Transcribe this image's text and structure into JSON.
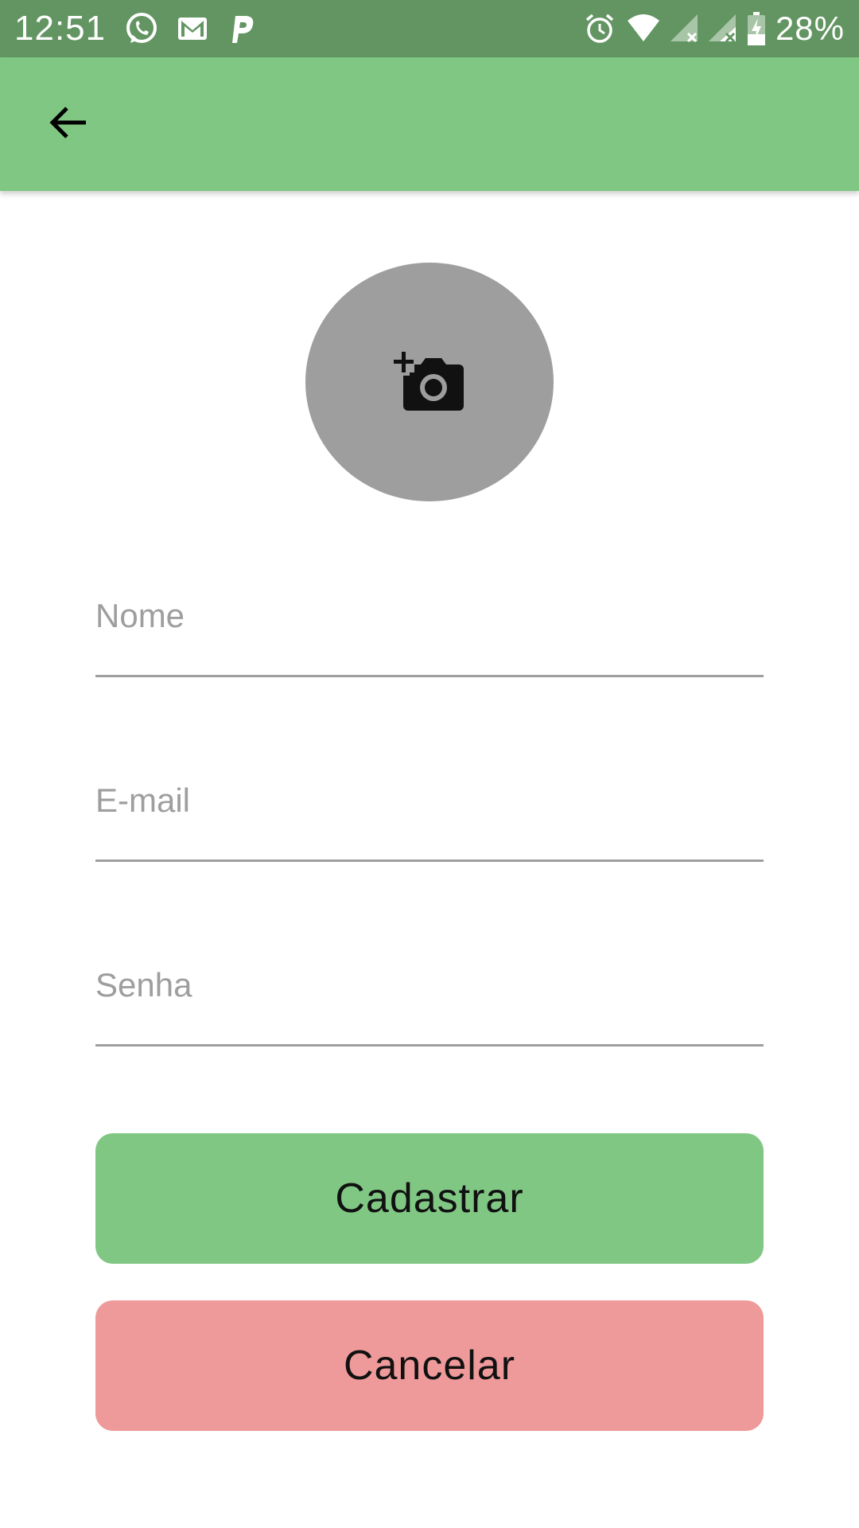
{
  "status_bar": {
    "time": "12:51",
    "battery": "28%",
    "background": "#629562",
    "left_icons": [
      "whatsapp-icon",
      "gmail-icon",
      "parking-p-icon"
    ],
    "right_icons": [
      "alarm-icon",
      "wifi-icon",
      "signal-no-sim-icon",
      "signal-no-sim-icon",
      "battery-charging-icon"
    ]
  },
  "app_bar": {
    "background": "#81c784",
    "back_icon": "arrow-back-icon"
  },
  "avatar": {
    "icon": "add-a-photo-icon",
    "background": "#9e9e9e"
  },
  "form": {
    "nome_placeholder": "Nome",
    "email_placeholder": "E-mail",
    "senha_placeholder": "Senha",
    "nome_value": "",
    "email_value": "",
    "senha_value": ""
  },
  "buttons": {
    "submit_label": "Cadastrar",
    "submit_color": "#81c784",
    "cancel_label": "Cancelar",
    "cancel_color": "#ef9a9a"
  }
}
